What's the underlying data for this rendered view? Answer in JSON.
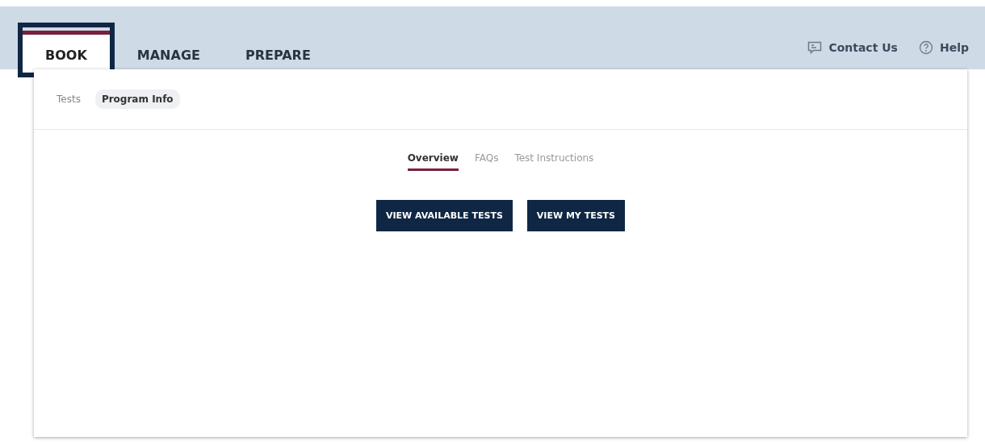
{
  "main_tabs": [
    {
      "label": "BOOK",
      "selected": true,
      "highlighted": true
    },
    {
      "label": "MANAGE",
      "selected": false,
      "highlighted": false
    },
    {
      "label": "PREPARE",
      "selected": false,
      "highlighted": false
    }
  ],
  "header_links": [
    {
      "kind": "contact",
      "label": "Contact Us"
    },
    {
      "kind": "help",
      "label": "Help"
    }
  ],
  "sub_tabs": [
    {
      "label": "Tests",
      "selected": false
    },
    {
      "label": "Program Info",
      "selected": true
    }
  ],
  "section_tabs": [
    {
      "label": "Overview",
      "selected": true
    },
    {
      "label": "FAQs",
      "selected": false
    },
    {
      "label": "Test Instructions",
      "selected": false
    }
  ],
  "buttons": [
    "VIEW AVAILABLE TESTS",
    "VIEW MY TESTS"
  ]
}
